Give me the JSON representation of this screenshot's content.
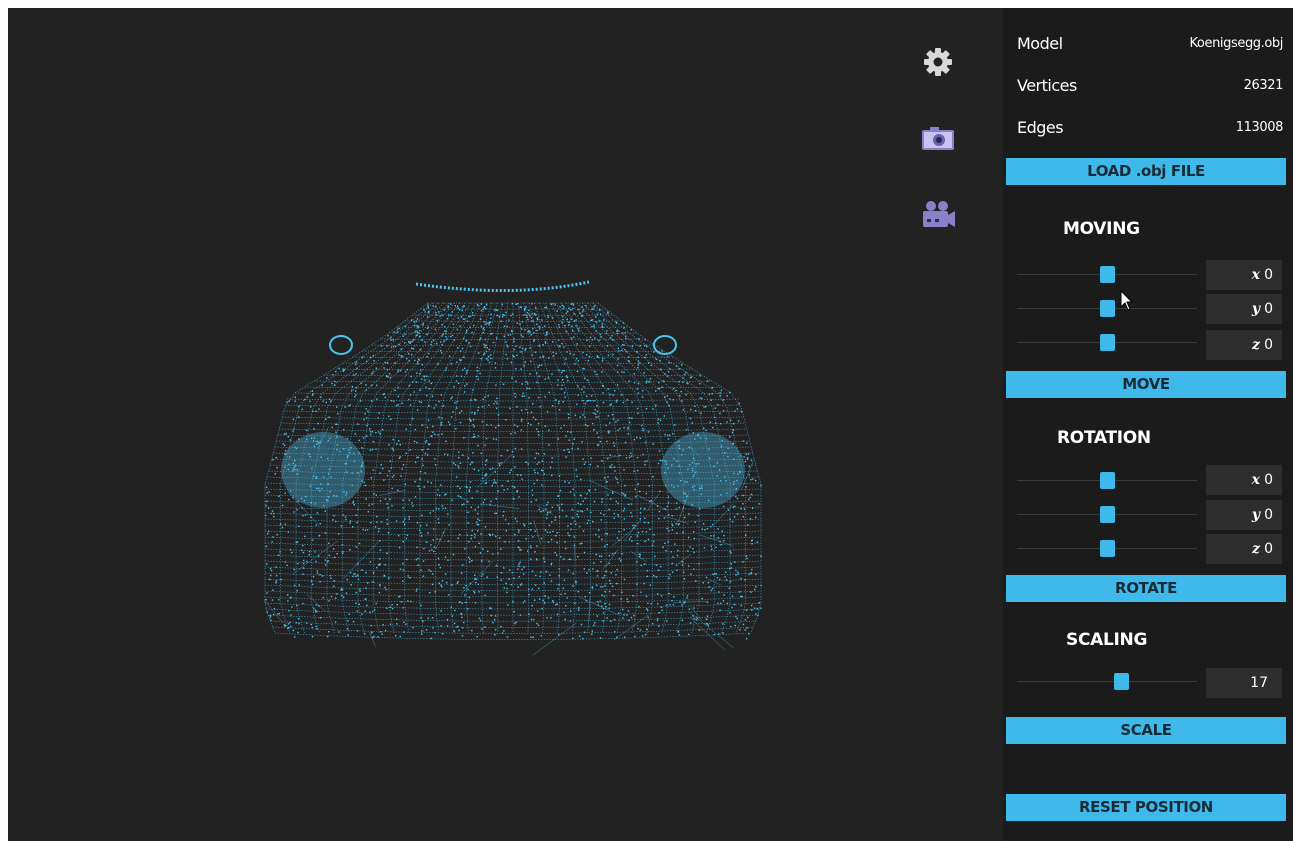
{
  "toolbar": {
    "settings_icon": "gear-icon",
    "screenshot_icon": "camera-icon",
    "record_icon": "video-camera-icon",
    "icon_color": "#8a80c8"
  },
  "model_info": {
    "model_label": "Model",
    "model_value": "Koenigsegg.obj",
    "vertices_label": "Vertices",
    "vertices_value": "26321",
    "edges_label": "Edges",
    "edges_value": "113008"
  },
  "load_button": "LOAD .obj FILE",
  "moving": {
    "title": "MOVING",
    "fields": [
      {
        "axis": "x",
        "value": "0"
      },
      {
        "axis": "y",
        "value": "0"
      },
      {
        "axis": "z",
        "value": "0"
      }
    ],
    "button": "MOVE"
  },
  "rotation": {
    "title": "ROTATION",
    "fields": [
      {
        "axis": "x",
        "value": "0"
      },
      {
        "axis": "y",
        "value": "0"
      },
      {
        "axis": "z",
        "value": "0"
      }
    ],
    "button": "ROTATE"
  },
  "scaling": {
    "title": "SCALING",
    "value": "17",
    "button": "SCALE"
  },
  "reset_button": "RESET POSITION",
  "colors": {
    "accent": "#3fb8ea",
    "viewport_bg": "#222222",
    "panel_bg": "#1b1b1b",
    "wireframe": "#4cc4f2"
  },
  "sliders": {
    "moving": [
      0.5,
      0.5,
      0.5
    ],
    "rotation": [
      0.5,
      0.5,
      0.5
    ],
    "scaling": 0.58
  }
}
